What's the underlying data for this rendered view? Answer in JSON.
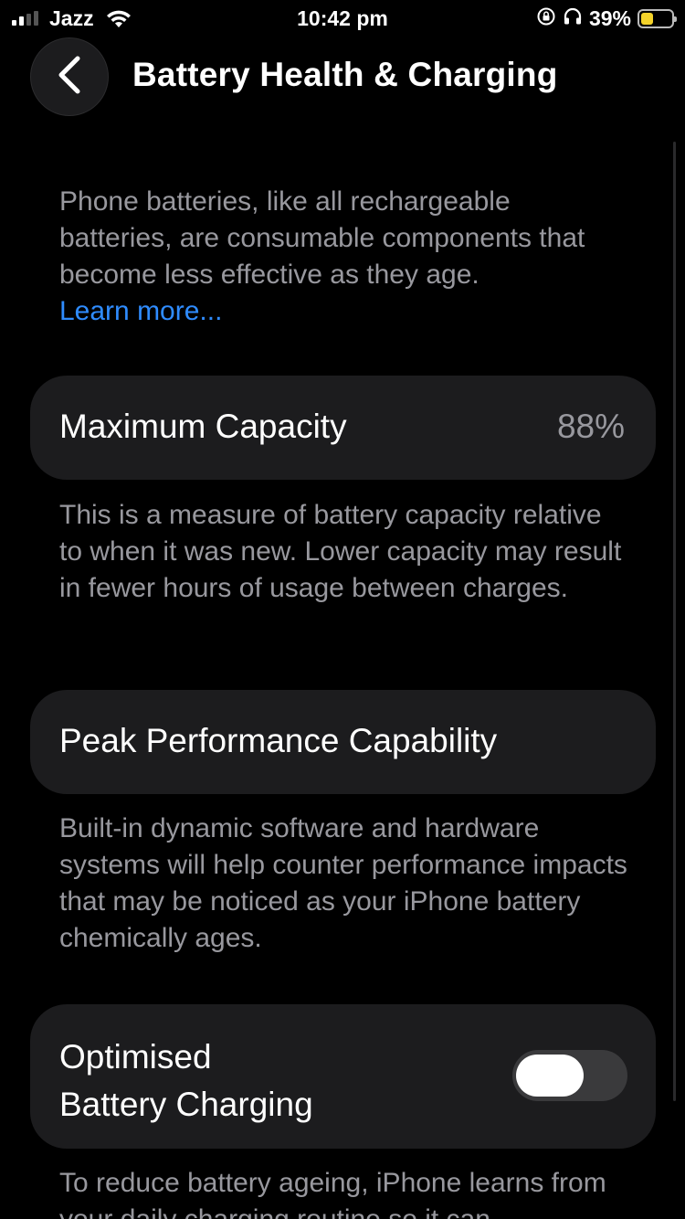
{
  "status_bar": {
    "carrier": "Jazz",
    "time": "10:42 pm",
    "battery_percent": "39%",
    "battery_level": 0.39,
    "battery_color": "#f4d32a",
    "signal_bars": 2,
    "icons": [
      "signal-icon",
      "wifi-icon",
      "orientation-lock-icon",
      "headphones-icon",
      "battery-icon"
    ]
  },
  "nav": {
    "back_icon": "chevron-left-icon",
    "title": "Battery Health & Charging"
  },
  "intro": {
    "text": "Phone batteries, like all rechargeable batteries, are consumable components that become less effective as they age.",
    "link": "Learn more..."
  },
  "max_capacity": {
    "label": "Maximum Capacity",
    "value": "88%",
    "description": "This is a measure of battery capacity relative to when it was new. Lower capacity may result in fewer hours of usage between charges."
  },
  "peak_performance": {
    "label": "Peak Performance Capability",
    "description": "Built-in dynamic software and hardware systems will help counter performance impacts that may be noticed as your iPhone battery chemically ages."
  },
  "optimised_charging": {
    "label_line1": "Optimised",
    "label_line2": "Battery Charging",
    "enabled": false,
    "description": "To reduce battery ageing, iPhone learns from your daily charging routine so it can"
  },
  "colors": {
    "link": "#2f8cff",
    "card_bg": "#1c1c1e",
    "secondary_text": "#98989e"
  }
}
